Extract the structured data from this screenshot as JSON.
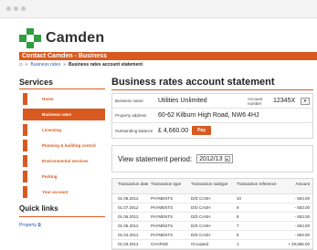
{
  "logo": {
    "text": "Camden"
  },
  "banner": {
    "text": "Contact Camden - Business"
  },
  "breadcrumb": [
    {
      "label": "Business rates"
    },
    {
      "label": "Business rates account statement"
    }
  ],
  "sidebar": {
    "title": "Services",
    "items": [
      {
        "label": "Home"
      },
      {
        "label": "Business rates"
      },
      {
        "label": "Licensing"
      },
      {
        "label": "Planning & building control"
      },
      {
        "label": "Environmental services"
      },
      {
        "label": "Parking"
      },
      {
        "label": "Your account"
      }
    ],
    "active_index": 1
  },
  "quick_links": {
    "title": "Quick links",
    "items": [
      {
        "label": "Property"
      }
    ]
  },
  "main": {
    "title": "Business rates account statement",
    "business_name_label": "Business name",
    "business_name": "Utilities Unlimited",
    "account_number_label": "Account number",
    "account_number": "12345X",
    "property_address_label": "Property address",
    "property_address": "60-62 Kilburn High Road, NW6 4HJ",
    "outstanding_label": "Outstanding balance",
    "outstanding_value": "£ 4,660.00",
    "pay_label": "Pay",
    "period_label": "View statement period:",
    "period_value": "2012/13"
  },
  "table": {
    "headers": [
      "Transaction date",
      "Transaction type",
      "Transaction subtype",
      "Transaction reference",
      "Amount"
    ],
    "rows": [
      [
        "01.08.2012",
        "PAYMENTS",
        "D/D CASH",
        "10",
        "- 653.00"
      ],
      [
        "01.07.2012",
        "PAYMENTS",
        "D/D CASH",
        "9",
        "- 653.00"
      ],
      [
        "01.06.2012",
        "PAYMENTS",
        "D/D CASH",
        "8",
        "- 653.00"
      ],
      [
        "01.05.2012",
        "PAYMENTS",
        "D/D CASH",
        "7",
        "- 653.00"
      ],
      [
        "01.04.2012",
        "PAYMENTS",
        "D/D CASH",
        "6",
        "- 653.00"
      ],
      [
        "01.03.2012",
        "CHARGE",
        "Occupied",
        "1",
        "+ 28,865.00"
      ]
    ]
  },
  "colors": {
    "accent": "#d85a20",
    "logo_green": "#2e9e3e",
    "link": "#2a5db0"
  }
}
